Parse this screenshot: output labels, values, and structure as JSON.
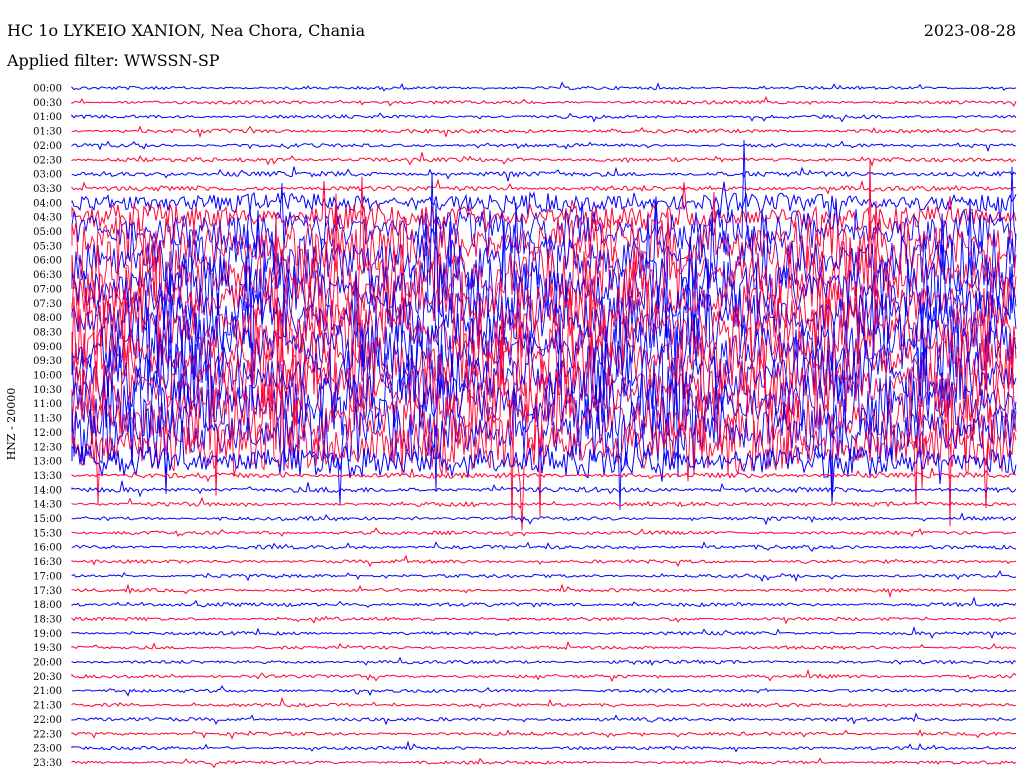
{
  "header": {
    "station": "HC 1o LYKEIO XANION, Nea Chora, Chania",
    "date": "2023-08-28",
    "filter": "Applied filter: WWSSN-SP"
  },
  "chart_data": {
    "type": "line",
    "title": "HC 1o LYKEIO XANION, Nea Chora, Chania",
    "subtitle": "Applied filter: WWSSN-SP",
    "ylabel": "HNZ - 20000",
    "colors": {
      "even": "#0000ff",
      "odd": "#ff0033"
    },
    "rows": [
      {
        "label": "00:00",
        "activity": 0.05
      },
      {
        "label": "00:30",
        "activity": 0.05
      },
      {
        "label": "01:00",
        "activity": 0.05
      },
      {
        "label": "01:30",
        "activity": 0.08
      },
      {
        "label": "02:00",
        "activity": 0.06
      },
      {
        "label": "02:30",
        "activity": 0.1
      },
      {
        "label": "03:00",
        "activity": 0.15
      },
      {
        "label": "03:30",
        "activity": 0.15
      },
      {
        "label": "04:00",
        "activity": 0.2
      },
      {
        "label": "04:30",
        "activity": 0.3
      },
      {
        "label": "05:00",
        "activity": 0.6
      },
      {
        "label": "05:30",
        "activity": 0.8
      },
      {
        "label": "06:00",
        "activity": 0.9
      },
      {
        "label": "06:30",
        "activity": 0.95
      },
      {
        "label": "07:00",
        "activity": 0.95
      },
      {
        "label": "07:30",
        "activity": 0.9
      },
      {
        "label": "08:00",
        "activity": 0.95
      },
      {
        "label": "08:30",
        "activity": 1.0
      },
      {
        "label": "09:00",
        "activity": 1.0
      },
      {
        "label": "09:30",
        "activity": 1.0
      },
      {
        "label": "10:00",
        "activity": 1.0
      },
      {
        "label": "10:30",
        "activity": 1.0
      },
      {
        "label": "11:00",
        "activity": 1.0
      },
      {
        "label": "11:30",
        "activity": 1.0
      },
      {
        "label": "12:00",
        "activity": 0.95
      },
      {
        "label": "12:30",
        "activity": 0.8
      },
      {
        "label": "13:00",
        "activity": 0.4
      },
      {
        "label": "13:30",
        "activity": 0.15
      },
      {
        "label": "14:00",
        "activity": 0.15
      },
      {
        "label": "14:30",
        "activity": 0.1
      },
      {
        "label": "15:00",
        "activity": 0.06
      },
      {
        "label": "15:30",
        "activity": 0.06
      },
      {
        "label": "16:00",
        "activity": 0.08
      },
      {
        "label": "16:30",
        "activity": 0.06
      },
      {
        "label": "17:00",
        "activity": 0.05
      },
      {
        "label": "17:30",
        "activity": 0.05
      },
      {
        "label": "18:00",
        "activity": 0.08
      },
      {
        "label": "18:30",
        "activity": 0.05
      },
      {
        "label": "19:00",
        "activity": 0.05
      },
      {
        "label": "19:30",
        "activity": 0.05
      },
      {
        "label": "20:00",
        "activity": 0.06
      },
      {
        "label": "20:30",
        "activity": 0.05
      },
      {
        "label": "21:00",
        "activity": 0.05
      },
      {
        "label": "21:30",
        "activity": 0.05
      },
      {
        "label": "22:00",
        "activity": 0.07
      },
      {
        "label": "22:30",
        "activity": 0.05
      },
      {
        "label": "23:00",
        "activity": 0.05
      },
      {
        "label": "23:30",
        "activity": 0.05
      }
    ]
  }
}
